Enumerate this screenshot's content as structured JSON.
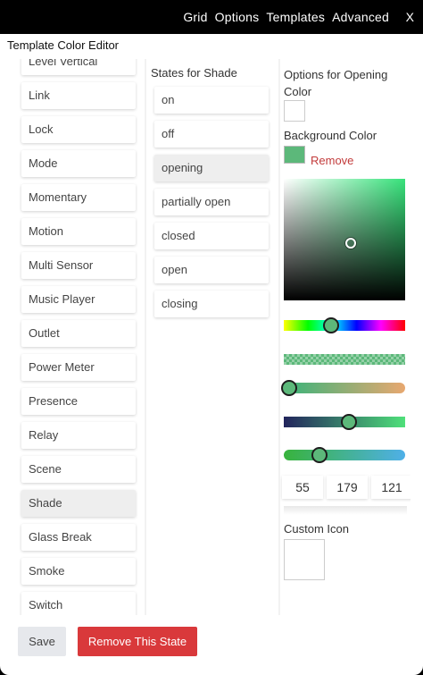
{
  "topnav": {
    "items": [
      "Grid",
      "Options",
      "Templates",
      "Advanced"
    ],
    "close": "X"
  },
  "panel_title": "Template Color Editor",
  "templates": {
    "items": [
      "Level Vertical",
      "Link",
      "Lock",
      "Mode",
      "Momentary",
      "Motion",
      "Multi Sensor",
      "Music Player",
      "Outlet",
      "Power Meter",
      "Presence",
      "Relay",
      "Scene",
      "Shade",
      "Glass Break",
      "Smoke",
      "Switch"
    ],
    "selected": "Shade"
  },
  "states": {
    "heading": "States for Shade",
    "items": [
      "on",
      "off",
      "opening",
      "partially open",
      "closed",
      "open",
      "closing"
    ],
    "selected": "opening"
  },
  "options": {
    "heading": "Options for Opening Color",
    "color_swatch": "#ffffff",
    "background_label": "Background Color",
    "background_color": "#37b379",
    "remove_label": "Remove",
    "rgb": [
      "55",
      "179",
      "121"
    ],
    "custom_icon_label": "Custom Icon"
  },
  "buttons": {
    "save": "Save",
    "remove_state": "Remove This State"
  },
  "colors": {
    "accent_red": "#d9393b",
    "topbar": "#000000"
  }
}
